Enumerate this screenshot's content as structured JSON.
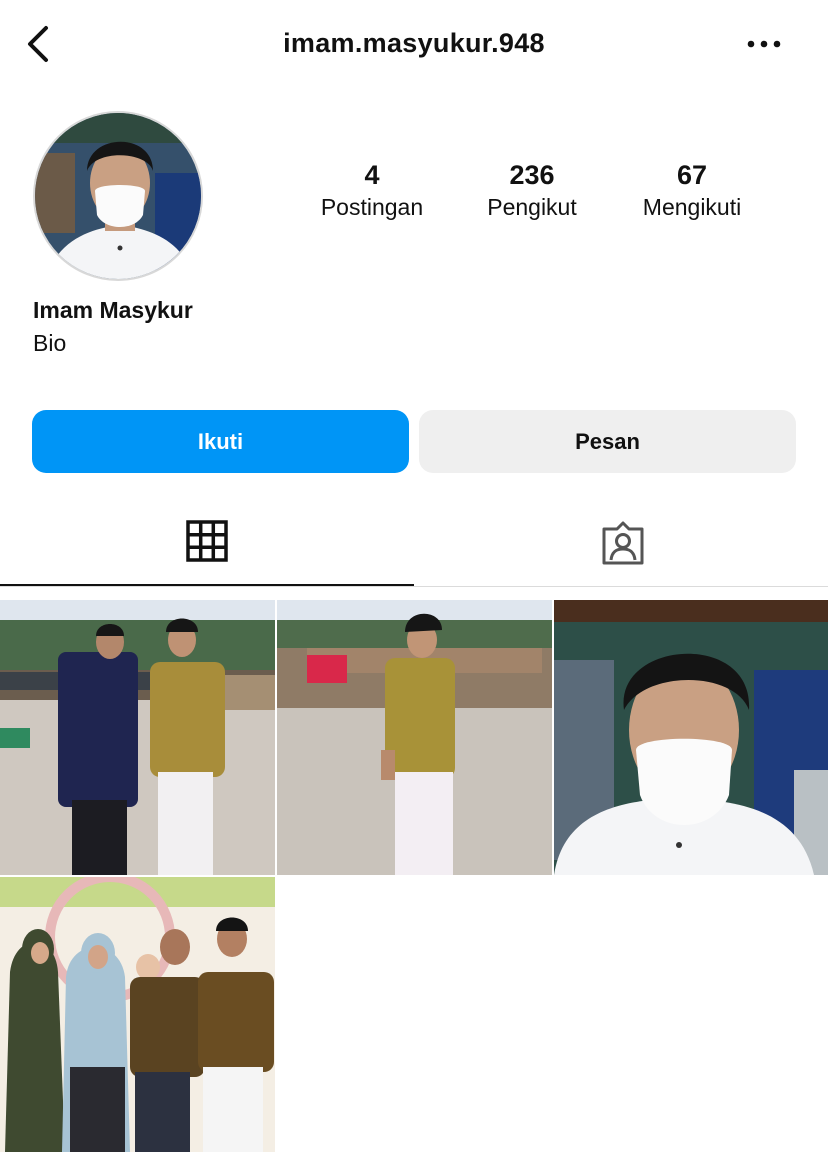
{
  "header": {
    "username": "imam.masyukur.948",
    "back_icon": "chevron-left-icon",
    "more_icon": "more-horizontal-icon"
  },
  "profile": {
    "full_name": "Imam Masykur",
    "bio": "Bio",
    "stats": {
      "posts_count": "4",
      "posts_label": "Postingan",
      "followers_count": "236",
      "followers_label": "Pengikut",
      "following_count": "67",
      "following_label": "Mengikuti"
    }
  },
  "actions": {
    "follow_label": "Ikuti",
    "message_label": "Pesan"
  },
  "tabs": [
    {
      "icon": "grid-icon",
      "active": true
    },
    {
      "icon": "tagged-user-icon",
      "active": false
    }
  ],
  "colors": {
    "accent": "#0095f6",
    "secondary_button": "#efefef",
    "divider": "#dbdbdb",
    "text": "#111111"
  },
  "posts": [
    {
      "description": "two men standing on beach"
    },
    {
      "description": "man in yellow shirt on beach"
    },
    {
      "description": "selfie man with face mask"
    },
    {
      "description": "family group photo"
    }
  ]
}
